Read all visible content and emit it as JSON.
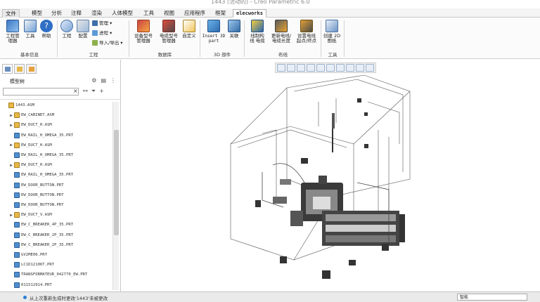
{
  "window": {
    "title": "1443 (活动的) - Creo Parametric 6.0"
  },
  "tabs": [
    "文件",
    "模型",
    "分析",
    "注释",
    "渲染",
    "人体模型",
    "工具",
    "视图",
    "应用程序",
    "框架",
    "elecworks"
  ],
  "ribbon": {
    "buttons": {
      "project_manager": "工程管\n理器",
      "tools": "工具",
      "help": "帮助",
      "project": "工程",
      "config": "配置",
      "device_mfr": "设备型号\n管理器",
      "cable_mfr": "电缆型号\n管理器",
      "custom": "自定义",
      "insert_3d": "Insert 3D\npart",
      "connect": "关联",
      "wire_route": "线制构\n线 电缆",
      "update_len": "更新电线/\n电缆长度",
      "set_start": "设置电线\n起点/终点",
      "create_2d": "创建 2D\n图纸"
    },
    "small": {
      "manage": "管理",
      "process": "进程",
      "import_export": "导入/导出"
    },
    "groups": [
      "基本信息",
      "工程",
      "数据库",
      "3D 部件",
      "布线",
      "工具"
    ]
  },
  "model_tree": {
    "title": "模型树",
    "search_placeholder": "",
    "items": [
      {
        "label": "1443.ASM",
        "type": "asm",
        "expand": "",
        "indent": 0
      },
      {
        "label": "EW_CABINET.ASM",
        "type": "asm",
        "expand": "▶",
        "indent": 1
      },
      {
        "label": "EW_DUCT_H.ASM",
        "type": "asm",
        "expand": "▶",
        "indent": 1
      },
      {
        "label": "EW_RAIL_H_OMEGA_35.PRT",
        "type": "prt",
        "expand": "",
        "indent": 1
      },
      {
        "label": "EW_DUCT_H.ASM",
        "type": "asm",
        "expand": "▶",
        "indent": 1
      },
      {
        "label": "EW_RAIL_H_OMEGA_35.PRT",
        "type": "prt",
        "expand": "",
        "indent": 1
      },
      {
        "label": "EW_DUCT_H.ASM",
        "type": "asm",
        "expand": "▶",
        "indent": 1
      },
      {
        "label": "EW_RAIL_H_OMEGA_35.PRT",
        "type": "prt",
        "expand": "",
        "indent": 1
      },
      {
        "label": "EW_DOOR_BUTTON.PRT",
        "type": "prt",
        "expand": "",
        "indent": 1
      },
      {
        "label": "EW_DOOR_BUTTON.PRT",
        "type": "prt",
        "expand": "",
        "indent": 1
      },
      {
        "label": "EW_DOOR_BUTTON.PRT",
        "type": "prt",
        "expand": "",
        "indent": 1
      },
      {
        "label": "EW_DUCT_V.ASM",
        "type": "asm",
        "expand": "▶",
        "indent": 1
      },
      {
        "label": "EW_C_BREAKER_4P_35.PRT",
        "type": "prt",
        "expand": "",
        "indent": 1
      },
      {
        "label": "EW_C_BREAKER_2P_35.PRT",
        "type": "prt",
        "expand": "",
        "indent": 1
      },
      {
        "label": "EW_C_BREAKER_2P_35.PRT",
        "type": "prt",
        "expand": "",
        "indent": 1
      },
      {
        "label": "GV2ME06.PRT",
        "type": "prt",
        "expand": "",
        "indent": 1
      },
      {
        "label": "LC1D12106T.PRT",
        "type": "prt",
        "expand": "",
        "indent": 1
      },
      {
        "label": "TRANSFORMATEUR_042770_EW.PRT",
        "type": "prt",
        "expand": "",
        "indent": 1
      },
      {
        "label": "011512914.PRT",
        "type": "prt",
        "expand": "",
        "indent": 1
      }
    ]
  },
  "status": {
    "message": "从上次重新生成时更改'1443'未被更改",
    "filter": "智能"
  },
  "colors": {
    "accent": "#2a7fd4",
    "asm": "#e8b94a",
    "prt": "#4f8fcf"
  }
}
